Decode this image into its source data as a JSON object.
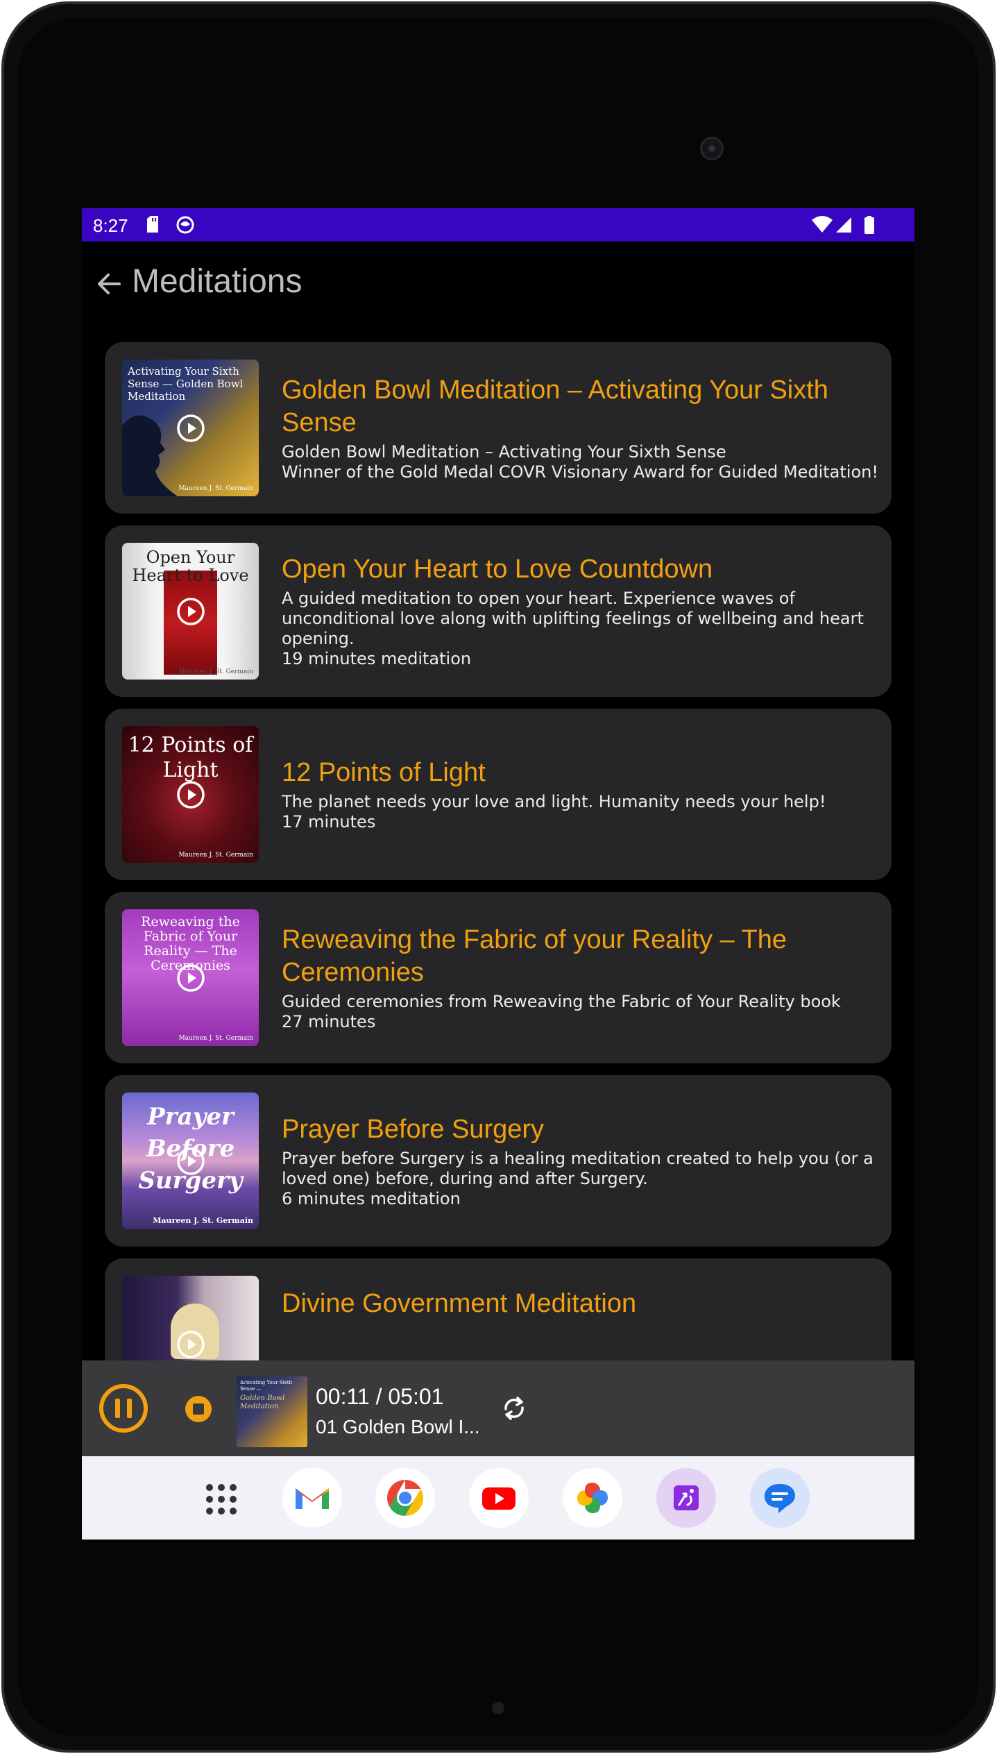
{
  "status_bar": {
    "time": "8:27"
  },
  "app_bar": {
    "title": "Meditations"
  },
  "meditations": [
    {
      "title": "Golden Bowl Meditation – Activating Your Sixth Sense",
      "lines": [
        "Golden Bowl Meditation – Activating Your Sixth Sense",
        "Winner of the Gold Medal COVR Visionary Award for Guided Meditation!"
      ],
      "thumb_text": "Activating Your Sixth Sense — Golden Bowl Meditation",
      "thumb_author": "Maureen J. St. Germain"
    },
    {
      "title": "Open Your Heart to Love Countdown",
      "lines": [
        "A guided meditation to open your heart. Experience waves of unconditional love along with uplifting feelings of wellbeing and heart opening.",
        "19 minutes meditation"
      ],
      "thumb_text": "Open Your Heart to Love",
      "thumb_author": "Maureen J. St. Germain"
    },
    {
      "title": "12 Points of Light",
      "lines": [
        "The planet needs your love and light. Humanity needs your help!",
        "17 minutes"
      ],
      "thumb_text": "12 Points of Light",
      "thumb_author": "Maureen J. St. Germain"
    },
    {
      "title": "Reweaving the Fabric of your Reality – The Ceremonies",
      "lines": [
        "Guided ceremonies from Reweaving the Fabric of Your Reality book",
        "27 minutes"
      ],
      "thumb_text": "Reweaving the Fabric of Your Reality — The Ceremonies",
      "thumb_author": "Maureen J. St. Germain"
    },
    {
      "title": "Prayer Before Surgery",
      "lines": [
        "Prayer before Surgery is a healing meditation created to help you (or a loved one) before, during and after Surgery.",
        "6 minutes meditation"
      ],
      "thumb_text": "Prayer Before Surgery",
      "thumb_author": "Maureen J. St. Germain"
    },
    {
      "title": "Divine Government Meditation",
      "lines": [],
      "thumb_text": "",
      "thumb_author": ""
    }
  ],
  "player": {
    "time": "00:11 / 05:01",
    "track": "01 Golden Bowl I...",
    "mini_thumb_text": "Activating Your Sixth Sense —",
    "mini_thumb_title": "Golden Bowl Meditation"
  },
  "dock": [
    "app-drawer",
    "gmail",
    "chrome",
    "youtube",
    "photos",
    "fitness-app",
    "messages"
  ],
  "colors": {
    "status_bar": "#3a05c2",
    "title_accent": "#f0a010",
    "card_background": "#262628",
    "player_background": "#3a3a3c",
    "player_accent": "#f0a010"
  }
}
